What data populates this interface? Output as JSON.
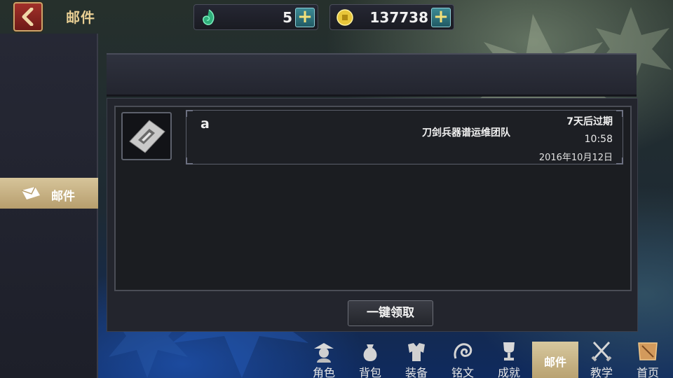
{
  "app": {
    "page_title": "邮件"
  },
  "currencies": [
    {
      "icon": "jade-icon",
      "value": "5"
    },
    {
      "icon": "gold-coin-icon",
      "value": "137738"
    }
  ],
  "sidebar": {
    "items": [
      {
        "label": "邮件",
        "icon": "envelope-icon",
        "selected": true
      }
    ]
  },
  "mail_list": [
    {
      "subject": "a",
      "sender": "刀剑兵器谱运维团队",
      "expire": "7天后过期",
      "time": "10:58",
      "date": "2016年10月12日"
    }
  ],
  "actions": {
    "claim_all": "一键领取"
  },
  "bottom_nav": [
    {
      "label": "角色",
      "icon": "character-icon"
    },
    {
      "label": "背包",
      "icon": "bag-icon"
    },
    {
      "label": "装备",
      "icon": "armor-icon"
    },
    {
      "label": "铭文",
      "icon": "inscription-icon"
    },
    {
      "label": "成就",
      "icon": "trophy-icon"
    },
    {
      "label": "邮件",
      "icon": "mail-icon",
      "active": true
    },
    {
      "label": "教学",
      "icon": "crossed-swords-icon"
    },
    {
      "label": "首页",
      "icon": "home-icon"
    }
  ],
  "colors": {
    "accent_gold": "#e9cf94",
    "active_tab": "#d7c89f",
    "back_button": "#a2302a"
  }
}
